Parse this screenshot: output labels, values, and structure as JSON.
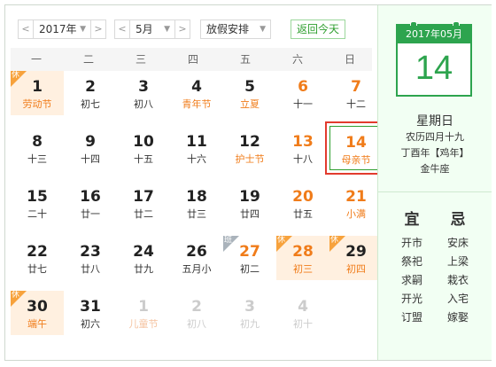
{
  "toolbar": {
    "prev_label": "<",
    "next_label": ">",
    "year": "2017年",
    "month": "5月",
    "holiday": "放假安排",
    "today": "返回今天"
  },
  "weekdays": [
    "一",
    "二",
    "三",
    "四",
    "五",
    "六",
    "日"
  ],
  "days": [
    {
      "d": "1",
      "l": "劳动节",
      "type": "holiday",
      "tag": "休"
    },
    {
      "d": "2",
      "l": "初七"
    },
    {
      "d": "3",
      "l": "初八"
    },
    {
      "d": "4",
      "l": "青年节",
      "type": "festival"
    },
    {
      "d": "5",
      "l": "立夏",
      "type": "festival"
    },
    {
      "d": "6",
      "l": "十一",
      "type": "weekend"
    },
    {
      "d": "7",
      "l": "十二",
      "type": "weekend"
    },
    {
      "d": "8",
      "l": "十三"
    },
    {
      "d": "9",
      "l": "十四"
    },
    {
      "d": "10",
      "l": "十五"
    },
    {
      "d": "11",
      "l": "十六"
    },
    {
      "d": "12",
      "l": "护士节",
      "type": "festival"
    },
    {
      "d": "13",
      "l": "十八",
      "type": "weekend"
    },
    {
      "d": "14",
      "l": "母亲节",
      "type": "weekend festival selected"
    },
    {
      "d": "15",
      "l": "二十"
    },
    {
      "d": "16",
      "l": "廿一"
    },
    {
      "d": "17",
      "l": "廿二"
    },
    {
      "d": "18",
      "l": "廿三"
    },
    {
      "d": "19",
      "l": "廿四"
    },
    {
      "d": "20",
      "l": "廿五",
      "type": "weekend"
    },
    {
      "d": "21",
      "l": "小满",
      "type": "weekend festival"
    },
    {
      "d": "22",
      "l": "廿七"
    },
    {
      "d": "23",
      "l": "廿八"
    },
    {
      "d": "24",
      "l": "廿九"
    },
    {
      "d": "26",
      "l": "五月小"
    },
    {
      "d": "27",
      "l": "初二",
      "type": "weekend",
      "tag": "班",
      "tagtype": "work"
    },
    {
      "d": "28",
      "l": "初三",
      "type": "holiday weekend",
      "tag": "休"
    },
    {
      "d": "29",
      "l": "初四",
      "type": "holiday",
      "tag": "休"
    },
    {
      "d": "30",
      "l": "端午",
      "type": "holiday",
      "tag": "休"
    },
    {
      "d": "31",
      "l": "初六"
    },
    {
      "d": "1",
      "l": "儿童节",
      "type": "other festival"
    },
    {
      "d": "2",
      "l": "初八",
      "type": "other"
    },
    {
      "d": "3",
      "l": "初九",
      "type": "other"
    },
    {
      "d": "4",
      "l": "初十",
      "type": "other"
    }
  ],
  "detail": {
    "header": "2017年05月",
    "day": "14",
    "weekday": "星期日",
    "lunar": "农历四月十九",
    "ganzhi": "丁酉年【鸡年】",
    "zodiac": "金牛座",
    "yi_label": "宜",
    "ji_label": "忌",
    "yi": [
      "开市",
      "祭祀",
      "求嗣",
      "开光",
      "订盟"
    ],
    "ji": [
      "安床",
      "上梁",
      "栽衣",
      "入宅",
      "嫁娶"
    ]
  }
}
